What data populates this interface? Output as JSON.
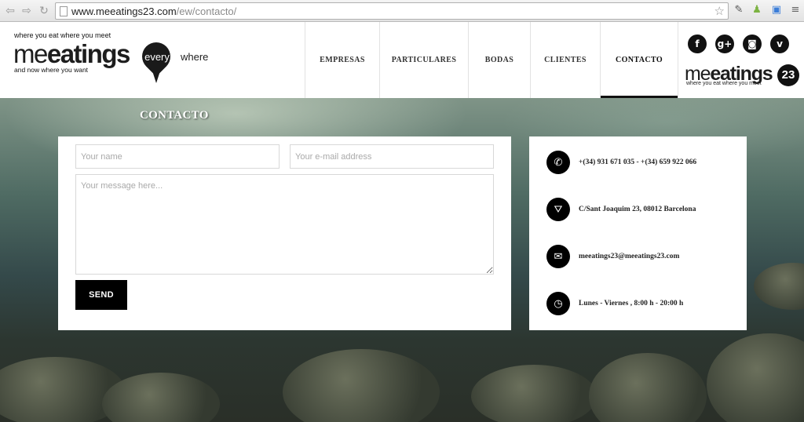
{
  "browser": {
    "url_host": "www.meeatings23.com",
    "url_path": "/ew/contacto/",
    "back_icon": "back-arrow-icon",
    "forward_icon": "forward-arrow-icon",
    "reload_icon": "reload-icon"
  },
  "header": {
    "logo": {
      "tagline_top": "where you eat where you meet",
      "word_light": "me",
      "word_bold": "eatings",
      "pin_text": "every",
      "after_pin": "where",
      "tagline_bottom": "and now where you want"
    },
    "menu": [
      {
        "label": "EMPRESAS",
        "active": false
      },
      {
        "label": "PARTICULARES",
        "active": false
      },
      {
        "label": "BODAS",
        "active": false
      },
      {
        "label": "CLIENTES",
        "active": false
      },
      {
        "label": "CONTACTO",
        "active": true
      }
    ],
    "social": [
      {
        "name": "facebook-icon",
        "glyph": "f"
      },
      {
        "name": "googleplus-icon",
        "glyph": "g+"
      },
      {
        "name": "instagram-icon",
        "glyph": "◙"
      },
      {
        "name": "vimeo-icon",
        "glyph": "v"
      }
    ],
    "logo2": {
      "word_light": "me",
      "word_bold": "eatings",
      "number": "23",
      "tagline": "where you eat where you meet"
    }
  },
  "page": {
    "title": "CONTACTO"
  },
  "form": {
    "name_placeholder": "Your name",
    "email_placeholder": "Your e-mail address",
    "message_placeholder": "Your message here...",
    "send_label": "SEND"
  },
  "contact_info": [
    {
      "icon": "phone-icon",
      "glyph": "✆",
      "text": "+(34) 931 671 035 - +(34) 659 922 066"
    },
    {
      "icon": "road-icon",
      "glyph": "⛛",
      "text": "C/Sant Joaquim 23, 08012 Barcelona"
    },
    {
      "icon": "envelope-icon",
      "glyph": "✉",
      "text": "meeatings23@meeatings23.com"
    },
    {
      "icon": "clock-icon",
      "glyph": "◷",
      "text": "Lunes - Viernes , 8:00 h - 20:00 h"
    }
  ]
}
